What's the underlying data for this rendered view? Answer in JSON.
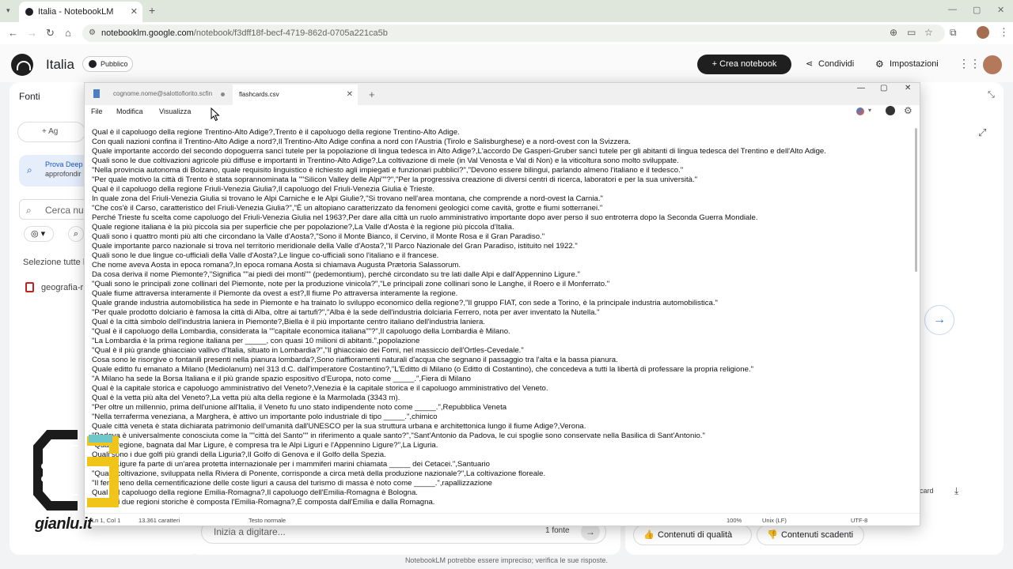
{
  "browser": {
    "tab_title": "Italia - NotebookLM",
    "tab_close": "✕",
    "new_tab": "+",
    "url_host": "notebooklm.google.com",
    "url_path": "/notebook/f3dff18f-becf-4719-862d-0705a221ca5b",
    "minimize": "—",
    "restore": "▢",
    "close": "✕",
    "back": "←",
    "forward": "→",
    "reload": "↻",
    "home": "⌂"
  },
  "notebook": {
    "title": "Italia",
    "visibility": "Pubblico",
    "create_button": "+ Crea notebook",
    "share_button": "Condividi",
    "settings_button": "Impostazioni"
  },
  "sources_panel": {
    "title": "Fonti",
    "add_button": "+ Ag",
    "deep_research_title": "Prova Deep",
    "deep_research_sub": "approfondir",
    "search_placeholder": "Cerca nu",
    "select_all": "Selezione tutte l",
    "source_file": "geografia-r"
  },
  "chat": {
    "placeholder": "Inizia a digitare...",
    "source_count": "1 fonte",
    "send_icon": "→"
  },
  "studio": {
    "card_label": "card",
    "quality_button": "Contenuti di qualità",
    "expired_button": "Contenuti scadenti"
  },
  "disclaimer": "NotebookLM potrebbe essere impreciso; verifica le sue risposte.",
  "notepad": {
    "tab1": "cognome.nome@salottofiorito.scfin",
    "tab2": "flashcards.csv",
    "menu": [
      "File",
      "Modifica",
      "Visualizza"
    ],
    "lines": [
      "Qual è il capoluogo della regione Trentino-Alto Adige?,Trento è il capoluogo della regione Trentino-Alto Adige.",
      "Con quali nazioni confina il Trentino-Alto Adige a nord?,Il Trentino-Alto Adige confina a nord con l'Austria (Tirolo e Salisburghese) e a nord-ovest con la Svizzera.",
      "Quale importante accordo del secondo dopoguerra sancì tutele per la popolazione di lingua tedesca in Alto Adige?,L'accordo De Gasperi-Gruber sancì tutele per gli abitanti di lingua tedesca del Trentino e dell'Alto Adige.",
      "Quali sono le due coltivazioni agricole più diffuse e importanti in Trentino-Alto Adige?,La coltivazione di mele (in Val Venosta e Val di Non) e la viticoltura sono molto sviluppate.",
      "\"Nella provincia autonoma di Bolzano, quale requisito linguistico è richiesto agli impiegati e funzionari pubblici?\",\"Devono essere bilingui, parlando almeno l'italiano e il tedesco.\"",
      "\"Per quale motivo la città di Trento è stata soprannominata la \"\"Silicon Valley delle Alpi\"\"?\",\"Per la progressiva creazione di diversi centri di ricerca, laboratori e per la sua università.\"",
      "Qual è il capoluogo della regione Friuli-Venezia Giulia?,Il capoluogo del Friuli-Venezia Giulia è Trieste.",
      "In quale zona del Friuli-Venezia Giulia si trovano le Alpi Carniche e le Alpi Giulie?,\"Si trovano nell'area montana, che comprende a nord-ovest la Carnia.\"",
      "\"Che cos'è il Carso, caratteristico del Friuli-Venezia Giulia?\",\"È un altopiano caratterizzato da fenomeni geologici come cavità, grotte e fiumi sotterranei.\"",
      "Perché Trieste fu scelta come capoluogo del Friuli-Venezia Giulia nel 1963?,Per dare alla città un ruolo amministrativo importante dopo aver perso il suo entroterra dopo la Seconda Guerra Mondiale.",
      "Quale regione italiana è la più piccola sia per superficie che per popolazione?,La Valle d'Aosta è la regione più piccola d'Italia.",
      "Quali sono i quattro monti più alti che circondano la Valle d'Aosta?,\"Sono il Monte Bianco, il Cervino, il Monte Rosa e il Gran Paradiso.\"",
      "Quale importante parco nazionale si trova nel territorio meridionale della Valle d'Aosta?,\"Il Parco Nazionale del Gran Paradiso, istituito nel 1922.\"",
      "Quali sono le due lingue co-ufficiali della Valle d'Aosta?,Le lingue co-ufficiali sono l'italiano e il francese.",
      "Che nome aveva Aosta in epoca romana?,In epoca romana Aosta si chiamava Augusta Prætoria Salassorum.",
      "Da cosa deriva il nome Piemonte?,\"Significa \"\"ai piedi dei monti\"\" (pedemontium), perché circondato su tre lati dalle Alpi e dall'Appennino Ligure.\"",
      "\"Quali sono le principali zone collinari del Piemonte, note per la produzione vinicola?\",\"Le principali zone collinari sono le Langhe, il Roero e il Monferrato.\"",
      "Quale fiume attraversa interamente il Piemonte da ovest a est?,Il fiume Po attraversa interamente la regione.",
      "Quale grande industria automobilistica ha sede in Piemonte e ha trainato lo sviluppo economico della regione?,\"Il gruppo FIAT, con sede a Torino, è la principale industria automobilistica.\"",
      "\"Per quale prodotto dolciario è famosa la città di Alba, oltre ai tartufi?\",\"Alba è la sede dell'industria dolciaria Ferrero, nota per aver inventato la Nutella.\"",
      "Qual è la città simbolo dell'industria laniera in Piemonte?,Biella è il più importante centro italiano dell'industria laniera.",
      "\"Qual è il capoluogo della Lombardia, considerata la \"\"capitale economica italiana\"\"?\",Il capoluogo della Lombardia è Milano.",
      "\"La Lombardia è la prima regione italiana per _____, con quasi 10 milioni di abitanti.\",popolazione",
      "\"Qual è il più grande ghiacciaio vallivo d'Italia, situato in Lombardia?\",\"Il ghiacciaio dei Forni, nel massiccio dell'Ortles-Cevedale.\"",
      "Cosa sono le risorgive o fontanili presenti nella pianura lombarda?,Sono riaffioramenti naturali d'acqua che segnano il passaggio tra l'alta e la bassa pianura.",
      "Quale editto fu emanato a Milano (Mediolanum) nel 313 d.C. dall'imperatore Costantino?,\"L'Editto di Milano (o Editto di Costantino), che concedeva a tutti la libertà di professare la propria religione.\"",
      "\"A Milano ha sede la Borsa Italiana e il più grande spazio espositivo d'Europa, noto come _____.\",Fiera di Milano",
      "Qual è la capitale storica e capoluogo amministrativo del Veneto?,Venezia è la capitale storica e il capoluogo amministrativo del Veneto.",
      "Qual è la vetta più alta del Veneto?,La vetta più alta della regione è la Marmolada (3343 m).",
      "\"Per oltre un millennio, prima dell'unione all'Italia, il Veneto fu uno stato indipendente noto come _____.\",Repubblica Veneta",
      "\"Nella terraferma veneziana, a Marghera, è attivo un importante polo industriale di tipo _____.\",chimico",
      "Quale città veneta è stata dichiarata patrimonio dell'umanità dall'UNESCO per la sua struttura urbana e architettonica lungo il fiume Adige?,Verona.",
      "\"Padova è universalmente conosciuta come la \"\"città del Santo\"\" in riferimento a quale santo?\",\"Sant'Antonio da Padova, le cui spoglie sono conservate nella Basilica di Sant'Antonio.\"",
      "\"Quale regione, bagnata dal Mar Ligure, è compresa tra le Alpi Liguri e l'Appennino Ligure?\",La Liguria.",
      "Quali sono i due golfi più grandi della Liguria?,Il Golfo di Genova e il Golfo della Spezia.",
      "\"Il Mar Ligure fa parte di un'area protetta internazionale per i mammiferi marini chiamata _____ dei Cetacei.\",Santuario",
      "\"Quale coltivazione, sviluppata nella Riviera di Ponente, corrisponde a circa metà della produzione nazionale?\",La coltivazione floreale.",
      "\"Il fenomeno della cementificazione delle coste liguri a causa del turismo di massa è noto come _____.\",rapallizzazione",
      "Qual è il capoluogo della regione Emilia-Romagna?,Il capoluogo dell'Emilia-Romagna è Bologna.",
      "Da quali due regioni storiche è composta l'Emilia-Romagna?,È composta dall'Emilia e dalla Romagna."
    ],
    "status": {
      "position": "Ln 1, Col 1",
      "chars": "13.361 caratteri",
      "format": "Testo normale",
      "zoom": "100%",
      "eol": "Unix (LF)",
      "encoding": "UTF-8"
    }
  },
  "watermark": {
    "text": "gianlu.it"
  }
}
